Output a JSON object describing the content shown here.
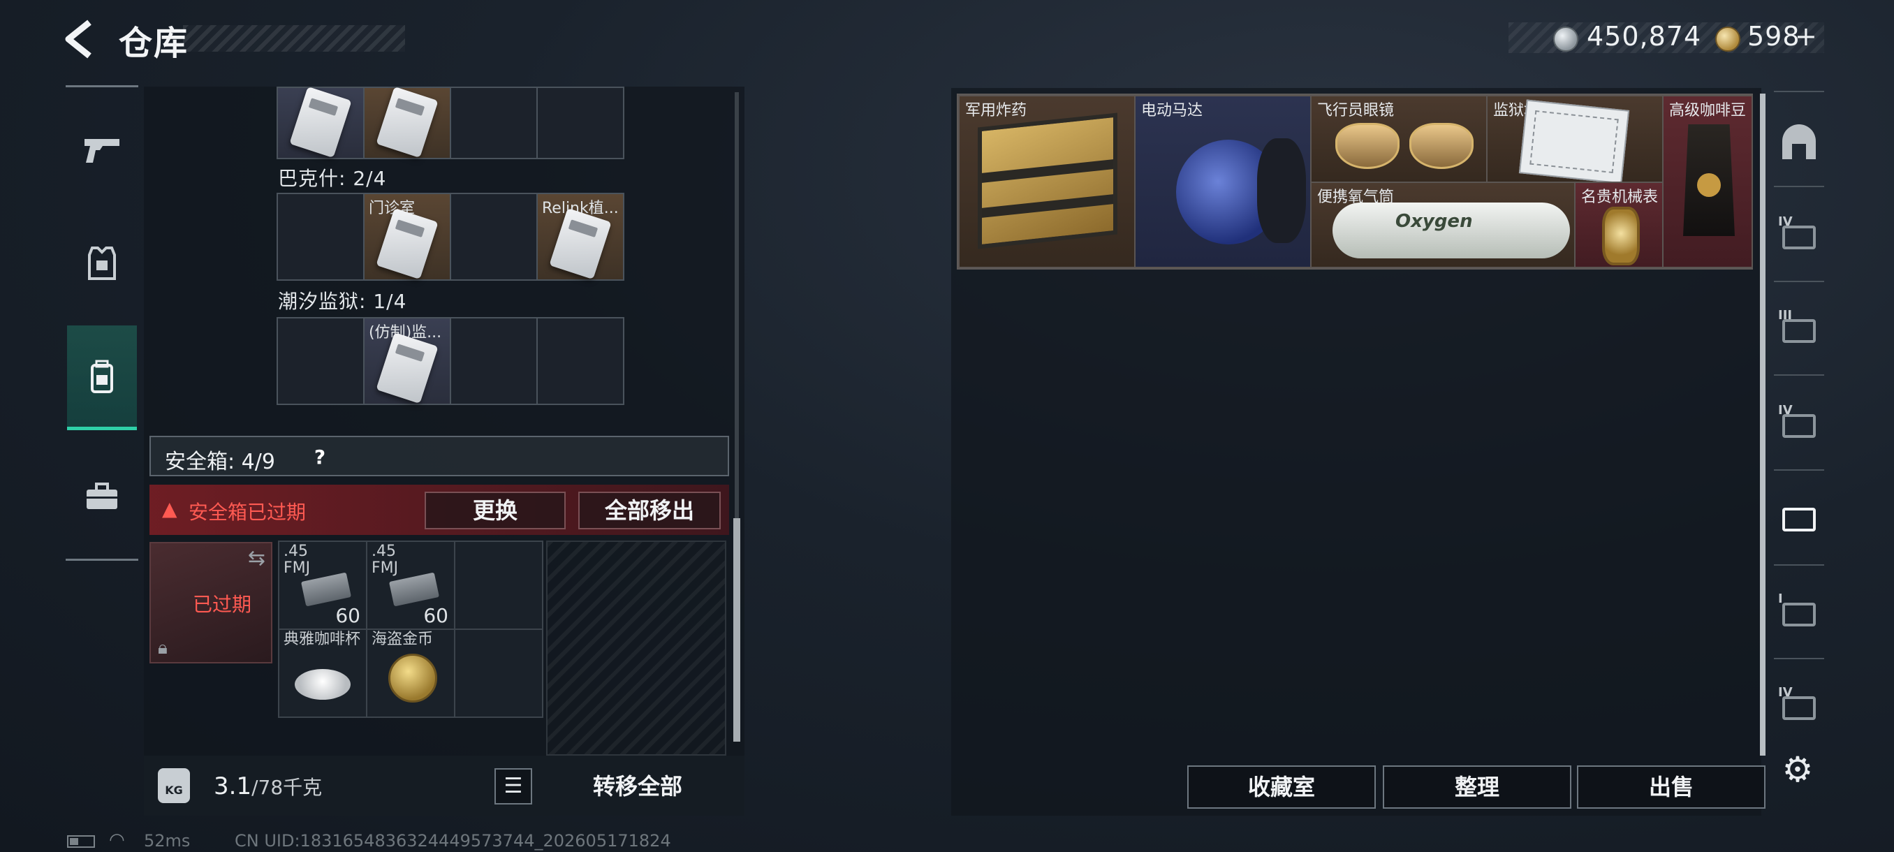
{
  "header": {
    "title": "仓库"
  },
  "currency": {
    "silver": "450,874",
    "gold": "598",
    "gold_add": "+"
  },
  "left_tabs": [
    {
      "name": "weapons",
      "icon": "gun-icon"
    },
    {
      "name": "armor",
      "icon": "vest-icon"
    },
    {
      "name": "backpack",
      "icon": "backpack-icon",
      "active": true
    },
    {
      "name": "supplies",
      "icon": "toolbox-icon"
    }
  ],
  "containers": [
    {
      "label": "巴克什: 2/4",
      "cells": [
        "",
        "门诊室",
        "",
        "Relink植..."
      ]
    },
    {
      "label": "潮汐监狱: 1/4",
      "cells": [
        "",
        "(仿制)监...",
        "",
        ""
      ]
    }
  ],
  "safebox": {
    "title": "安全箱: 4/9",
    "help": "?",
    "expired_text": "安全箱已过期",
    "replace_label": "更换",
    "move_all_label": "全部移出",
    "item_status": "已过期",
    "items": [
      {
        "label": ".45\nFMJ",
        "count": "60"
      },
      {
        "label": ".45\nFMJ",
        "count": "60"
      },
      {
        "label": "典雅咖啡杯",
        "count": ""
      },
      {
        "label": "海盗金币",
        "count": ""
      }
    ]
  },
  "bottom_left": {
    "weight": "3.1",
    "capacity": "/78千克",
    "weight_icon": "KG",
    "transfer_all_label": "转移全部"
  },
  "stash_items": [
    {
      "label": "军用炸药",
      "color": "brown"
    },
    {
      "label": "电动马达",
      "color": "blue"
    },
    {
      "label": "飞行员眼镜",
      "color": "brown"
    },
    {
      "label": "监狱地图1",
      "color": "brown"
    },
    {
      "label": "高级咖啡豆",
      "color": "red"
    },
    {
      "label": "便携氧气筒",
      "color": "brown",
      "text": "Oxygen"
    },
    {
      "label": "名贵机械表",
      "color": "red"
    }
  ],
  "right_nav": [
    "IV",
    "III",
    "IV",
    "",
    "I",
    "IV"
  ],
  "right_buttons": {
    "collection": "收藏室",
    "sort": "整理",
    "sell": "出售"
  },
  "status": {
    "ping": "52ms",
    "uid": "CN UID:1831654836324449573744_202605171824"
  },
  "colors": {
    "accent": "#2fd0a8",
    "warning": "#ff5a52",
    "item_brown": "#4b3a2e",
    "item_blue": "#2c3350",
    "item_red": "#5e2a30"
  }
}
